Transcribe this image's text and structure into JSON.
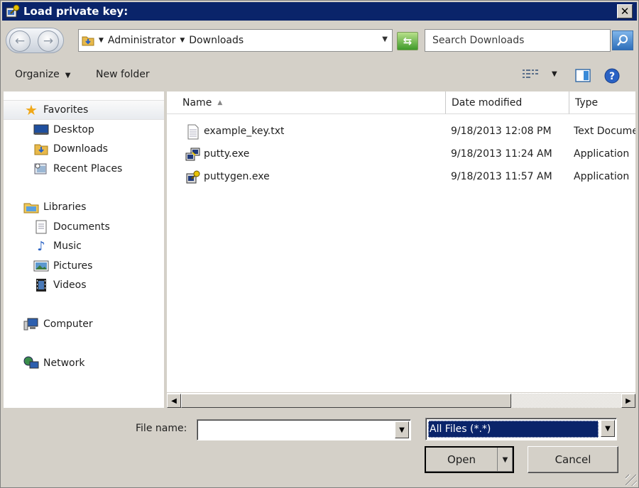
{
  "window": {
    "title": "Load private key:",
    "close_label": "✕"
  },
  "address": {
    "crumbs": [
      "Administrator",
      "Downloads"
    ],
    "search_placeholder": "Search Downloads"
  },
  "toolbar": {
    "organize_label": "Organize",
    "new_folder_label": "New folder"
  },
  "nav": {
    "favorites": "Favorites",
    "desktop": "Desktop",
    "downloads": "Downloads",
    "recent_places": "Recent Places",
    "libraries": "Libraries",
    "documents": "Documents",
    "music": "Music",
    "pictures": "Pictures",
    "videos": "Videos",
    "computer": "Computer",
    "network": "Network"
  },
  "columns": {
    "name": "Name",
    "date_modified": "Date modified",
    "type": "Type"
  },
  "files": [
    {
      "name": "example_key.txt",
      "date": "9/18/2013 12:08 PM",
      "type": "Text Document"
    },
    {
      "name": "putty.exe",
      "date": "9/18/2013 11:24 AM",
      "type": "Application"
    },
    {
      "name": "puttygen.exe",
      "date": "9/18/2013 11:57 AM",
      "type": "Application"
    }
  ],
  "bottom": {
    "file_name_label": "File name:",
    "file_name_value": "",
    "file_type_value": "All Files (*.*)",
    "open_label": "Open",
    "cancel_label": "Cancel"
  },
  "scroll": {
    "horizontal_position_fraction": 0.0,
    "horizontal_visible_fraction": 0.75
  },
  "colors": {
    "title_bar": "#0a246a",
    "dialog_face": "#d4d0c8",
    "selection": "#0a246a"
  }
}
